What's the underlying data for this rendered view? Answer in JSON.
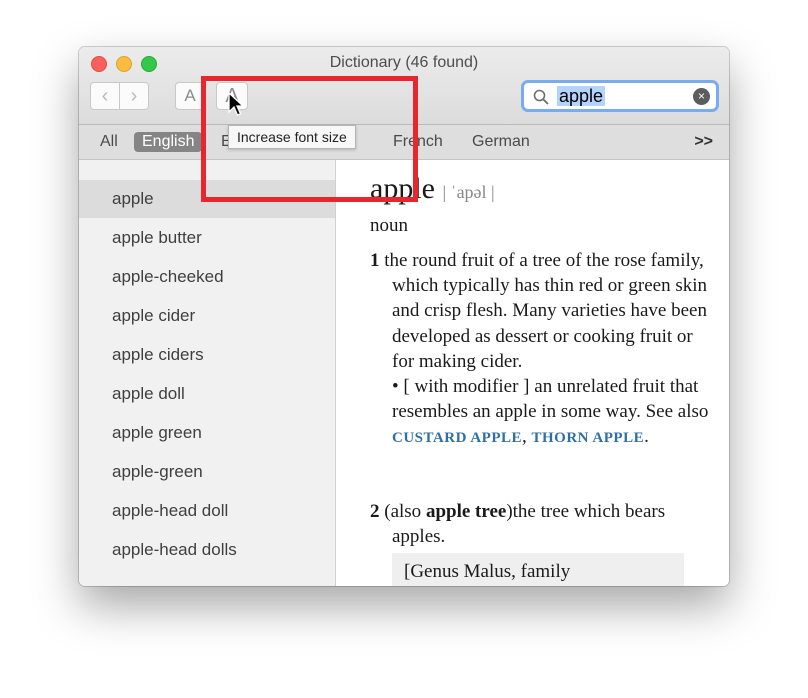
{
  "window": {
    "title": "Dictionary (46 found)"
  },
  "toolbar": {
    "back_label": "‹",
    "forward_label": "›",
    "font_decrease_label": "A",
    "font_increase_label": "A",
    "tooltip": "Increase font size"
  },
  "search": {
    "value": "apple",
    "clear_label": "×"
  },
  "tabs": {
    "items": [
      "All",
      "English",
      "E",
      "French",
      "German"
    ],
    "selected": "English",
    "more_label": ">>"
  },
  "sidebar": {
    "items": [
      "apple",
      "apple butter",
      "apple-cheeked",
      "apple cider",
      "apple ciders",
      "apple doll",
      "apple green",
      "apple-green",
      "apple-head doll",
      "apple-head dolls"
    ],
    "selected_index": 0
  },
  "entry": {
    "headword": "apple",
    "pronunciation": "| ˈapəl |",
    "part_of_speech": "noun",
    "sense1_num": "1",
    "sense1_text": "the round fruit of a tree of the rose family, which typically has thin red or green skin and crisp flesh. Many varieties have been developed as dessert or cooking fruit or for making cider.",
    "sense1_sub_pre": "• [ with modifier ] an unrelated fruit that resembles an apple in some way. See also",
    "xref1": "CUSTARD APPLE",
    "xref_sep": ",",
    "xref2": "THORN APPLE",
    "xref_end": ".",
    "sense2_num": "2",
    "sense2_pre": "(also",
    "sense2_bold": "apple tree",
    "sense2_post": ")the tree which bears apples.",
    "genus_note": "[Genus Malus, family"
  },
  "colors": {
    "highlight_box": "#e8262d",
    "search_focus": "#79abf0",
    "xref": "#2f6fa8"
  }
}
